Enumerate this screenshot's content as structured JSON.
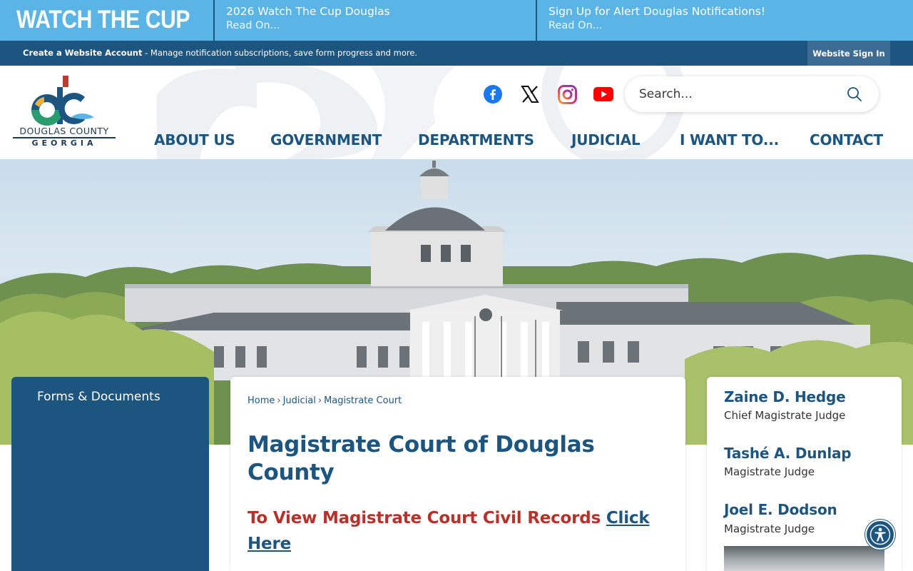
{
  "alert_bar": {
    "title": "WATCH THE CUP",
    "items": [
      {
        "heading": "2026 Watch The Cup Douglas",
        "link": "Read On..."
      },
      {
        "heading": "Sign Up for Alert Douglas Notifications!",
        "link": "Read On..."
      }
    ]
  },
  "account_bar": {
    "create_label": "Create a Website Account",
    "description": " - Manage notification subscriptions, save form progress and more.",
    "sign_in": "Website Sign In"
  },
  "logo": {
    "line1": "DOUGLAS COUNTY",
    "line2": "GEORGIA"
  },
  "social": [
    "facebook-icon",
    "x-icon",
    "instagram-icon",
    "youtube-icon"
  ],
  "search": {
    "placeholder": "Search..."
  },
  "nav": {
    "items": [
      "ABOUT US",
      "GOVERNMENT",
      "DEPARTMENTS",
      "JUDICIAL",
      "I WANT TO...",
      "CONTACT"
    ]
  },
  "sidebar": {
    "items": [
      "Forms & Documents"
    ]
  },
  "breadcrumb": {
    "items": [
      "Home",
      "Judicial",
      "Magistrate Court"
    ]
  },
  "main": {
    "title": "Magistrate Court of Douglas County",
    "records_text": "To View Magistrate Court Civil Records ",
    "records_link": "Click Here"
  },
  "judges": [
    {
      "name": "Zaine D. Hedge",
      "title": "Chief Magistrate Judge"
    },
    {
      "name": "Tashé A. Dunlap",
      "title": "Magistrate Judge"
    },
    {
      "name": "Joel E. Dodson",
      "title": "Magistrate Judge"
    }
  ],
  "colors": {
    "primary": "#1d5581",
    "alert_bar": "#5ab4e5",
    "accent_red": "#b7312a"
  }
}
